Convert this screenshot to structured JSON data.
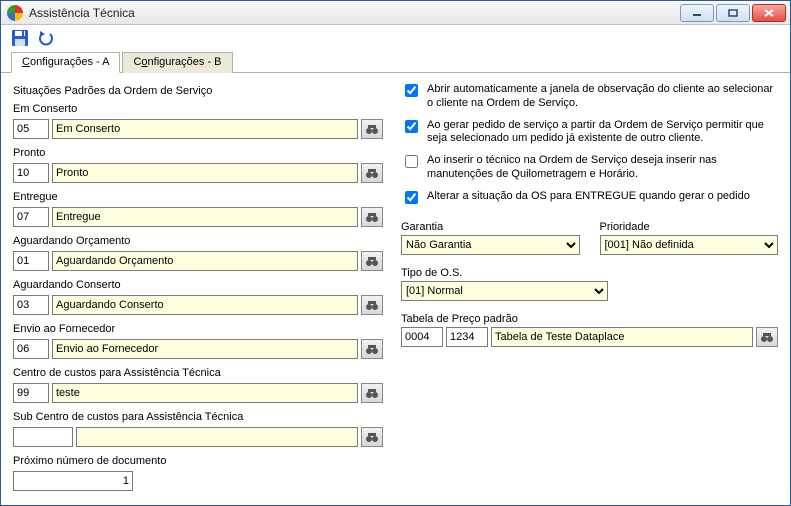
{
  "window": {
    "title": "Assistência Técnica"
  },
  "tabs": {
    "a": "Configurações - A",
    "b": "Configurações - B"
  },
  "left": {
    "section_title": "Situações Padrões da Ordem de Serviço",
    "em_conserto": {
      "label": "Em Conserto",
      "code": "05",
      "desc": "Em Conserto"
    },
    "pronto": {
      "label": "Pronto",
      "code": "10",
      "desc": "Pronto"
    },
    "entregue": {
      "label": "Entregue",
      "code": "07",
      "desc": "Entregue"
    },
    "aguardando_orcamento": {
      "label": "Aguardando Orçamento",
      "code": "01",
      "desc": "Aguardando Orçamento"
    },
    "aguardando_conserto": {
      "label": "Aguardando Conserto",
      "code": "03",
      "desc": "Aguardando Conserto"
    },
    "envio_fornecedor": {
      "label": "Envio ao Fornecedor",
      "code": "06",
      "desc": "Envio ao Fornecedor"
    },
    "centro_custos": {
      "label": "Centro de custos para  Assistência Técnica",
      "code": "99",
      "desc": "teste"
    },
    "sub_centro_custos": {
      "label": "Sub Centro de custos para Assistência Técnica",
      "code": "",
      "desc": ""
    },
    "proximo_numero": {
      "label": "Próximo número de documento",
      "value": "1"
    }
  },
  "right": {
    "chk1": "Abrir automaticamente a janela de observação do cliente ao selecionar o cliente na Ordem de Serviço.",
    "chk2": "Ao gerar pedido de serviço a partir da Ordem de Serviço permitir que seja selecionado um pedido já existente de outro cliente.",
    "chk3": "Ao inserir o técnico na Ordem de Serviço deseja inserir nas manutenções de Quilometragem e Horário.",
    "chk4": "Alterar a situação da OS para ENTREGUE quando gerar o pedido",
    "garantia": {
      "label": "Garantia",
      "value": "Não Garantia"
    },
    "prioridade": {
      "label": "Prioridade",
      "value": "[001] Não definida"
    },
    "tipo_os": {
      "label": "Tipo de O.S.",
      "value": "[01] Normal"
    },
    "tabela_preco": {
      "label": "Tabela de Preço padrão",
      "code1": "0004",
      "code2": "1234",
      "desc": "Tabela de Teste Dataplace"
    }
  }
}
